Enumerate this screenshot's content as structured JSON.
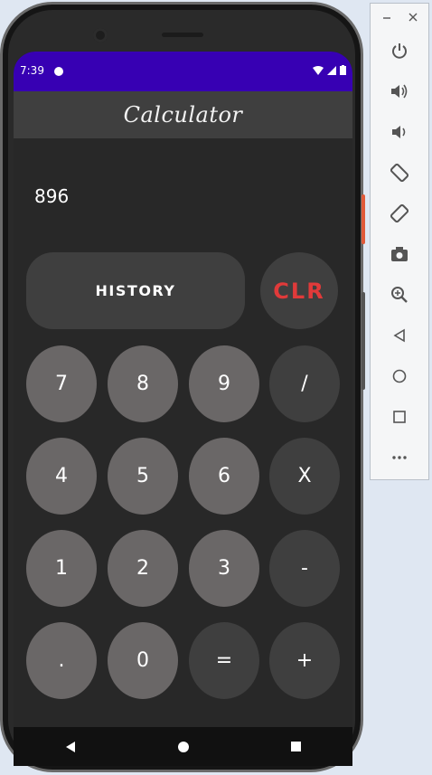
{
  "status": {
    "time": "7:39"
  },
  "app": {
    "title": "Calculator"
  },
  "display": {
    "value": "896"
  },
  "controls": {
    "history_label": "HISTORY",
    "clear_label": "CLR"
  },
  "keys": {
    "k7": "7",
    "k8": "8",
    "k9": "9",
    "div": "/",
    "k4": "4",
    "k5": "5",
    "k6": "6",
    "mul": "X",
    "k1": "1",
    "k2": "2",
    "k3": "3",
    "sub": "-",
    "dot": ".",
    "k0": "0",
    "eq": "=",
    "add": "+"
  },
  "colors": {
    "statusbar": "#3700b3",
    "appbar": "#3f3f3f",
    "background": "#282828",
    "number_key": "#6a6767",
    "operator_key": "#3f3f3f",
    "clear_text": "#e03a3a"
  },
  "emulator_panel": {
    "icons": [
      "minimize-icon",
      "close-icon",
      "power-icon",
      "volume-up-icon",
      "volume-down-icon",
      "rotate-left-icon",
      "rotate-right-icon",
      "camera-icon",
      "zoom-icon",
      "back-icon",
      "home-icon",
      "overview-icon",
      "more-icon"
    ]
  }
}
